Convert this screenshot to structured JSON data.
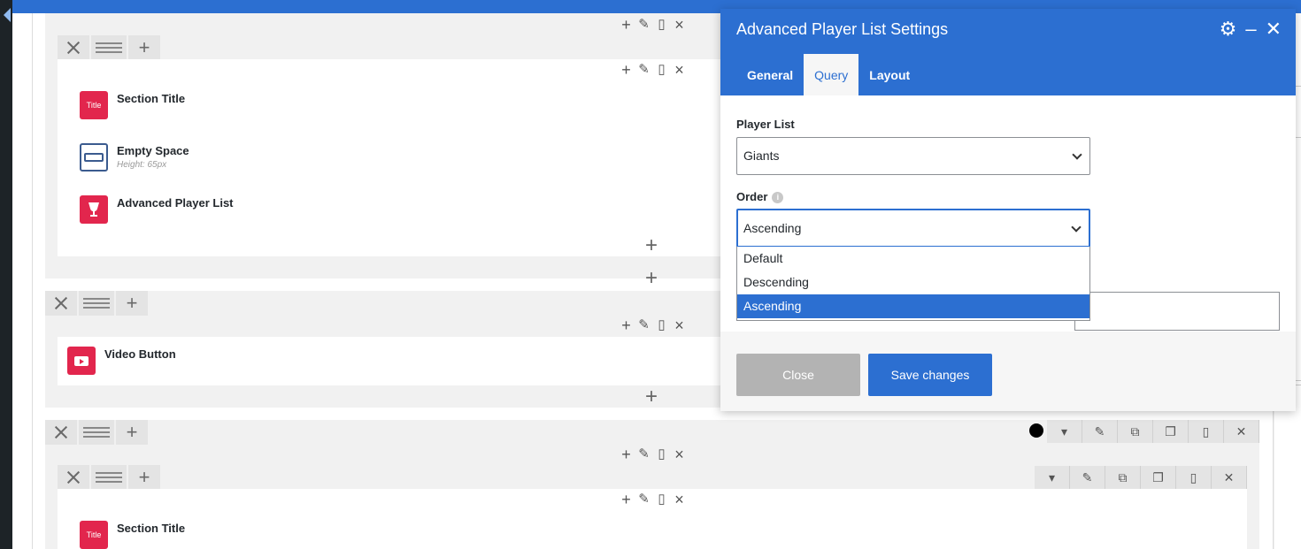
{
  "dialog": {
    "title": "Advanced Player List Settings",
    "tabs": [
      {
        "label": "General"
      },
      {
        "label": "Query"
      },
      {
        "label": "Layout"
      }
    ],
    "fields": {
      "player_list": {
        "label": "Player List",
        "value": "Giants"
      },
      "order": {
        "label": "Order",
        "value": "Ascending",
        "options": [
          "Default",
          "Descending",
          "Ascending"
        ]
      }
    },
    "buttons": {
      "close": "Close",
      "save": "Save changes"
    }
  },
  "builder": {
    "elements": [
      {
        "title": "Section Title",
        "icon_text": "Title"
      },
      {
        "title": "Empty Space",
        "sub": "Height: 65px"
      },
      {
        "title": "Advanced Player List"
      },
      {
        "title": "Video Button"
      },
      {
        "title": "Section Title",
        "icon_text": "Title"
      }
    ]
  },
  "colors": {
    "accent": "#2c6fd1",
    "element_red": "#e2264d"
  }
}
